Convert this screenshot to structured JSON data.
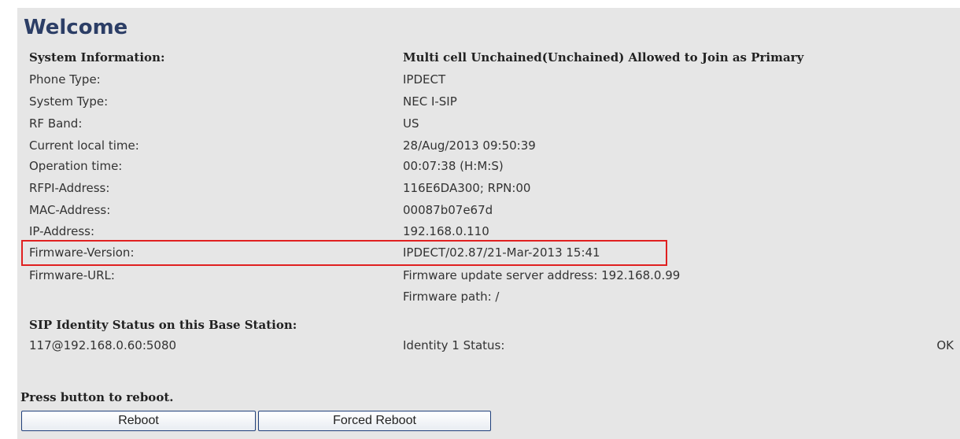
{
  "title": "Welcome",
  "system_info": {
    "header_label": "System Information:",
    "header_value": "Multi cell Unchained(Unchained) Allowed to Join as Primary",
    "rows": [
      {
        "label": "Phone Type:",
        "value": "IPDECT"
      },
      {
        "label": "System Type:",
        "value": "NEC I-SIP"
      },
      {
        "label": "RF Band:",
        "value": "US"
      },
      {
        "label": "Current local time:",
        "value": "28/Aug/2013 09:50:39"
      },
      {
        "label": "Operation time:",
        "value": "00:07:38 (H:M:S)"
      },
      {
        "label": "RFPI-Address:",
        "value": "116E6DA300; RPN:00"
      },
      {
        "label": "MAC-Address:",
        "value": "00087b07e67d"
      },
      {
        "label": "IP-Address:",
        "value": "192.168.0.110"
      },
      {
        "label": "Firmware-Version:",
        "value": "IPDECT/02.87/21-Mar-2013 15:41"
      },
      {
        "label": "Firmware-URL:",
        "value": "Firmware update server address: 192.168.0.99"
      },
      {
        "label": "",
        "value": "Firmware path: /"
      }
    ]
  },
  "sip": {
    "header": "SIP Identity Status on this Base Station:",
    "identity": "117@192.168.0.60:5080",
    "status_label": "Identity 1 Status:",
    "status_value": "OK"
  },
  "reboot": {
    "prompt": "Press button to reboot.",
    "reboot_label": "Reboot",
    "forced_label": "Forced Reboot"
  },
  "colors": {
    "background": "#e6e6e6",
    "title": "#2c3e66",
    "highlight_border": "#e02020"
  }
}
